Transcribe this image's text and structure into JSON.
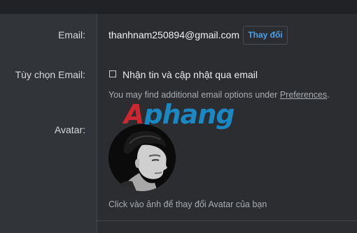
{
  "labels": {
    "email": "Email:",
    "email_options": "Tùy chọn Email:",
    "avatar": "Avatar:"
  },
  "email": {
    "value": "thanhnam250894@gmail.com",
    "change_button": "Thay đổi"
  },
  "email_options": {
    "checkbox_label": "Nhận tin và cập nhật qua email",
    "checked": false,
    "hint_prefix": "You may find additional email options under ",
    "hint_link": "Preferences",
    "hint_suffix": "."
  },
  "watermark": {
    "part1": "A",
    "part2": "phang"
  },
  "avatar": {
    "hint": "Click vào ảnh để thay đổi Avatar của bạn"
  },
  "colors": {
    "background": "#2b2d30",
    "label_column": "#313438",
    "accent_link": "#4aa3f0",
    "watermark_red": "#d9282f",
    "watermark_blue": "#1a8fd0"
  }
}
